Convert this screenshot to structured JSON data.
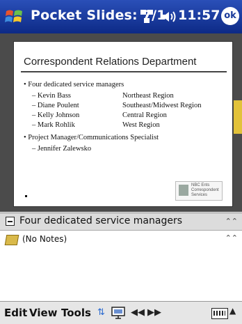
{
  "titlebar": {
    "app_title": "Pocket Slides: 7/1",
    "clock": "11:57",
    "ok_label": "ok",
    "icons": [
      "start-icon",
      "network-icon",
      "volume-icon",
      "ok-icon"
    ]
  },
  "slide": {
    "title": "Correspondent Relations Department",
    "bullets": [
      {
        "text": "• Four dedicated service managers"
      },
      {
        "name": "– Kevin Bass",
        "region": "Northeast Region"
      },
      {
        "name": "– Diane Poulent",
        "region": "Southeast/Midwest Region"
      },
      {
        "name": "– Kelly Johnson",
        "region": "Central Region"
      },
      {
        "name": "– Mark Rohlik",
        "region": "West Region"
      },
      {
        "text": "• Project Manager/Communications Specialist"
      },
      {
        "name": "– Jennifer Zalewsko"
      }
    ],
    "logo_text": "NBC Ents Correspondent Services"
  },
  "outline": {
    "text": "Four dedicated service managers"
  },
  "notes": {
    "text": "(No Notes)"
  },
  "menubar": {
    "edit": "Edit",
    "view": "View",
    "tools": "Tools"
  },
  "colors": {
    "titlebar": "#1a3a9a",
    "slide_bg": "#4b4b4b",
    "accent": "#e2c23a"
  }
}
